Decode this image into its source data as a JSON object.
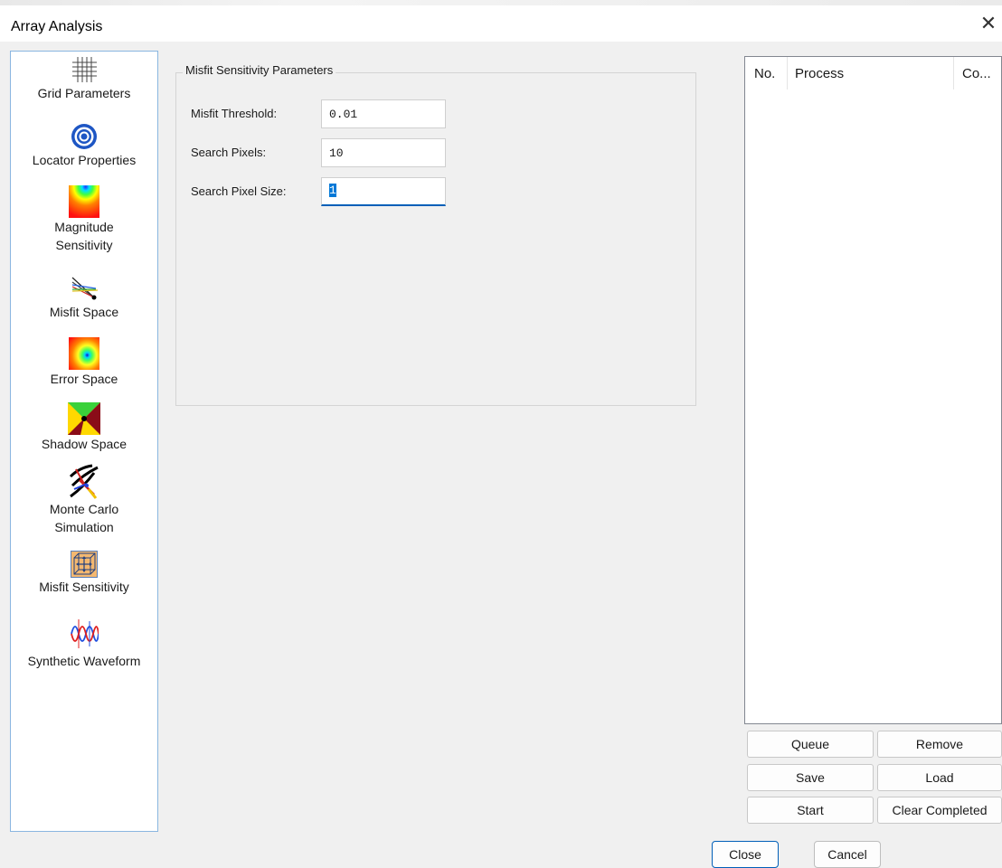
{
  "window": {
    "title": "Array Analysis",
    "close_glyph": "✕"
  },
  "sidebar": {
    "items": [
      {
        "label": "Grid Parameters",
        "icon": "grid-icon"
      },
      {
        "label": "Locator Properties",
        "icon": "target-icon"
      },
      {
        "label": "Magnitude Sensitivity",
        "icon": "heatmap-icon"
      },
      {
        "label": "Misfit Space",
        "icon": "rays-icon"
      },
      {
        "label": "Error Space",
        "icon": "error-heatmap-icon"
      },
      {
        "label": "Shadow Space",
        "icon": "shadow-icon"
      },
      {
        "label": "Monte Carlo Simulation",
        "icon": "monte-carlo-icon"
      },
      {
        "label": "Misfit Sensitivity",
        "icon": "cube-icon",
        "selected": true
      },
      {
        "label": "Synthetic Waveform",
        "icon": "waveform-icon"
      }
    ]
  },
  "params": {
    "group_title": "Misfit Sensitivity Parameters",
    "misfit_threshold_label": "Misfit Threshold:",
    "misfit_threshold_value": "0.01",
    "search_pixels_label": "Search Pixels:",
    "search_pixels_value": "10",
    "search_pixel_size_label": "Search Pixel Size:",
    "search_pixel_size_value": "1"
  },
  "process_list": {
    "columns": [
      "No.",
      "Process",
      "Co..."
    ],
    "rows": []
  },
  "queue_buttons": {
    "queue": "Queue",
    "remove": "Remove",
    "save": "Save",
    "load": "Load",
    "start": "Start",
    "clear_completed": "Clear Completed"
  },
  "footer": {
    "close": "Close",
    "cancel": "Cancel"
  }
}
